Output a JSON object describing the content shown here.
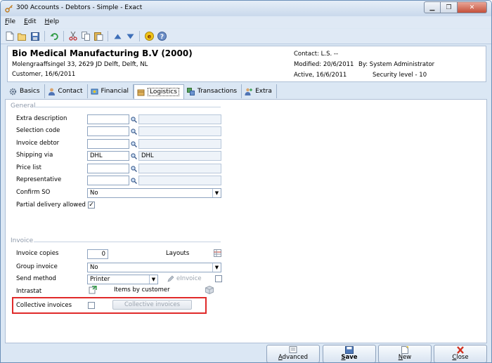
{
  "window": {
    "title": "300 Accounts - Debtors - Simple - Exact"
  },
  "menu": [
    {
      "label": "File",
      "key": "F",
      "rest": "ile"
    },
    {
      "label": "Edit",
      "key": "E",
      "rest": "dit"
    },
    {
      "label": "Help",
      "key": "H",
      "rest": "elp"
    }
  ],
  "header": {
    "name": "Bio Medical Manufacturing B.V (2000)",
    "address": "Molengraaffsingel 33, 2629 JD Delft, Delft, NL",
    "customer": "Customer, 16/6/2011",
    "contact": "Contact: L.S. --",
    "modified": "Modified: 20/6/2011",
    "by": "By: System Administrator",
    "active": "Active, 16/6/2011",
    "security": "Security level - 10"
  },
  "tabs": [
    "Basics",
    "Contact",
    "Financial",
    "Logistics",
    "Transactions",
    "Extra"
  ],
  "general": {
    "section_title": "General",
    "extra_description": {
      "label": "Extra description",
      "value": ""
    },
    "selection_code": {
      "label": "Selection code",
      "value": ""
    },
    "invoice_debtor": {
      "label": "Invoice debtor",
      "value": ""
    },
    "shipping_via": {
      "label": "Shipping via",
      "value": "DHL",
      "description": "DHL"
    },
    "price_list": {
      "label": "Price list",
      "value": ""
    },
    "representative": {
      "label": "Representative",
      "value": ""
    },
    "confirm_so": {
      "label": "Confirm SO",
      "value": "No"
    },
    "partial_delivery": {
      "label": "Partial delivery allowed",
      "checked": "✓"
    }
  },
  "invoice": {
    "section_title": "Invoice",
    "invoice_copies": {
      "label": "Invoice copies",
      "value": "0"
    },
    "layouts_label": "Layouts",
    "group_invoice": {
      "label": "Group invoice",
      "value": "No"
    },
    "send_method": {
      "label": "Send method",
      "value": "Printer"
    },
    "einvoice_label": "eInvoice",
    "intrastat_label": "Intrastat",
    "items_by_customer_label": "Items by customer",
    "collective_invoices": {
      "label": "Collective invoices",
      "button_label": "Collective invoices"
    }
  },
  "buttons": {
    "advanced": {
      "key": "A",
      "rest": "dvanced"
    },
    "save": {
      "key": "S",
      "rest": "ave"
    },
    "new": {
      "key": "N",
      "rest": "ew"
    },
    "close": {
      "key": "C",
      "rest": "lose"
    }
  }
}
